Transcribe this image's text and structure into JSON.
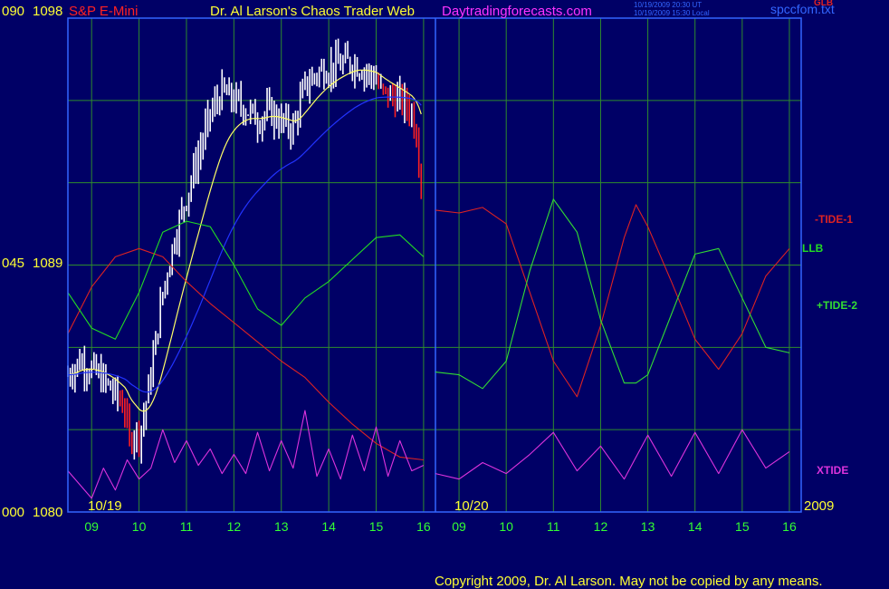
{
  "header": {
    "left_scale_top": "090",
    "price_top": "1098",
    "symbol": "S&P E-Mini",
    "title": "Dr. Al Larson's Chaos Trader Web",
    "site": "Daytradingforecasts.com",
    "stamp_utc": "10/19/2009 20:30 UT",
    "stamp_local": "10/19/2009 15:30 Local",
    "file": "spccfom.txt",
    "top_right_label": "GLB"
  },
  "axis": {
    "left_labels": [
      {
        "scale": "090",
        "price": "1098"
      },
      {
        "scale": "045",
        "price": "1089"
      },
      {
        "scale": "000",
        "price": "1080"
      }
    ],
    "date_labels": [
      "10/19",
      "10/20"
    ],
    "year": "2009",
    "hour_labels": [
      "09",
      "10",
      "11",
      "12",
      "13",
      "14",
      "15",
      "16",
      "09",
      "10",
      "11",
      "12",
      "13",
      "14",
      "15",
      "16"
    ]
  },
  "footer": {
    "copyright": "Copyright 2009, Dr. Al Larson. May not be copied by any means."
  },
  "colors": {
    "background": "#000066",
    "grid": "#2e8b2e",
    "frame": "#3366ff",
    "price_up": "#ffffff",
    "price_down": "#ff2020",
    "avg_fast": "#ffff66",
    "avg_slow": "#2233ff",
    "tide1": "#dd2222",
    "llb": "#22dd22",
    "tide2": "#33dd33",
    "xtide": "#dd33dd",
    "axis_text": "#ffff33",
    "hour_text": "#33ff33",
    "copyright": "#ffff33"
  },
  "chart_data": {
    "type": "line",
    "x_unit": "market hours, two sessions (10/19 and 10/20, 2009), 08:30–16:15 each",
    "ylim": [
      1080,
      1098
    ],
    "y_ticks": [
      1080,
      1089,
      1098
    ],
    "grid": true,
    "legend": "right",
    "annotations": [
      "-TIDE-1",
      "LLB",
      "+TIDE-2",
      "XTIDE",
      "GLB"
    ],
    "price_close": {
      "name": "S&P E-Mini",
      "x": [
        8.5,
        8.75,
        9.0,
        9.25,
        9.5,
        9.7,
        9.8,
        9.9,
        10.0,
        10.1,
        10.25,
        10.5,
        10.75,
        11.0,
        11.25,
        11.5,
        11.75,
        12.0,
        12.25,
        12.5,
        12.75,
        13.0,
        13.25,
        13.5,
        13.75,
        14.0,
        14.25,
        14.5,
        14.75,
        15.0,
        15.1,
        15.25,
        15.5,
        15.65,
        15.75,
        15.85,
        15.95,
        16.0
      ],
      "y": [
        1085.0,
        1085.5,
        1085.2,
        1084.8,
        1084.3,
        1083.8,
        1082.5,
        1083.0,
        1082.8,
        1083.5,
        1085.0,
        1088.0,
        1090.0,
        1091.5,
        1093.0,
        1094.5,
        1095.3,
        1095.0,
        1094.7,
        1094.3,
        1094.6,
        1094.2,
        1094.0,
        1095.5,
        1096.0,
        1096.2,
        1096.3,
        1096.4,
        1096.1,
        1095.8,
        1095.3,
        1095.2,
        1095.0,
        1094.8,
        1094.6,
        1093.8,
        1092.2,
        1090.3
      ]
    },
    "series": [
      {
        "name": "-TIDE-1",
        "session": 1,
        "x": [
          8.5,
          9.0,
          9.5,
          10.0,
          10.5,
          11.0,
          11.5,
          12.0,
          12.5,
          13.0,
          13.5,
          14.0,
          14.5,
          15.0,
          15.5,
          16.0
        ],
        "y": [
          1086.5,
          1088.2,
          1089.3,
          1089.6,
          1089.3,
          1088.4,
          1087.6,
          1086.9,
          1086.2,
          1085.5,
          1084.9,
          1084.0,
          1083.2,
          1082.5,
          1082.0,
          1081.9
        ]
      },
      {
        "name": "-TIDE-1",
        "session": 2,
        "x": [
          16.0,
          9.0,
          9.5,
          10.0,
          10.5,
          11.0,
          11.5,
          12.0,
          12.5,
          12.75,
          13.0,
          13.5,
          14.0,
          14.5,
          15.0,
          15.5,
          16.0
        ],
        "y": [
          1091.0,
          1090.9,
          1091.1,
          1090.5,
          1088.0,
          1085.5,
          1084.2,
          1086.8,
          1090.0,
          1091.2,
          1090.4,
          1088.4,
          1086.3,
          1085.2,
          1086.5,
          1088.6,
          1089.6
        ]
      },
      {
        "name": "LLB",
        "session": 1,
        "x": [
          8.5,
          9.0,
          9.5,
          10.0,
          10.5,
          11.0,
          11.5,
          12.0,
          12.5,
          13.0,
          13.5,
          14.0,
          14.5,
          15.0,
          15.5,
          16.0
        ],
        "y": [
          1088.0,
          1086.7,
          1086.3,
          1088.0,
          1090.2,
          1090.6,
          1090.4,
          1089.0,
          1087.4,
          1086.8,
          1087.8,
          1088.4,
          1089.2,
          1090.0,
          1090.1,
          1089.3
        ]
      },
      {
        "name": "+TIDE-2",
        "session": 2,
        "x": [
          16.0,
          9.0,
          9.5,
          10.0,
          10.5,
          11.0,
          11.5,
          12.0,
          12.5,
          12.75,
          13.0,
          13.5,
          14.0,
          14.5,
          15.0,
          15.5,
          16.0
        ],
        "y": [
          1085.1,
          1085.0,
          1084.5,
          1085.5,
          1088.8,
          1091.4,
          1090.2,
          1087.0,
          1084.7,
          1084.7,
          1085.0,
          1087.2,
          1089.4,
          1089.6,
          1087.8,
          1086.0,
          1085.8
        ]
      },
      {
        "name": "XTIDE",
        "session": 1,
        "x": [
          8.5,
          9.0,
          9.25,
          9.5,
          9.75,
          10.0,
          10.25,
          10.5,
          10.75,
          11.0,
          11.25,
          11.5,
          11.75,
          12.0,
          12.25,
          12.5,
          12.75,
          13.0,
          13.25,
          13.5,
          13.75,
          14.0,
          14.25,
          14.5,
          14.75,
          15.0,
          15.25,
          15.5,
          15.75,
          16.0
        ],
        "y": [
          1081.5,
          1080.5,
          1081.6,
          1080.8,
          1081.9,
          1081.2,
          1081.6,
          1083.0,
          1081.8,
          1082.6,
          1081.7,
          1082.3,
          1081.4,
          1082.1,
          1081.4,
          1082.9,
          1081.5,
          1082.6,
          1081.6,
          1083.7,
          1081.3,
          1082.3,
          1081.2,
          1082.8,
          1081.5,
          1083.1,
          1081.3,
          1082.6,
          1081.5,
          1081.7
        ]
      },
      {
        "name": "XTIDE",
        "session": 2,
        "x": [
          16.0,
          9.0,
          9.5,
          10.0,
          10.5,
          11.0,
          11.5,
          12.0,
          12.5,
          13.0,
          13.5,
          14.0,
          14.5,
          15.0,
          15.5,
          16.0
        ],
        "y": [
          1081.4,
          1081.2,
          1081.8,
          1081.4,
          1082.1,
          1082.9,
          1081.5,
          1082.4,
          1081.2,
          1082.8,
          1081.3,
          1082.9,
          1081.4,
          1083.0,
          1081.6,
          1082.2
        ]
      }
    ]
  }
}
